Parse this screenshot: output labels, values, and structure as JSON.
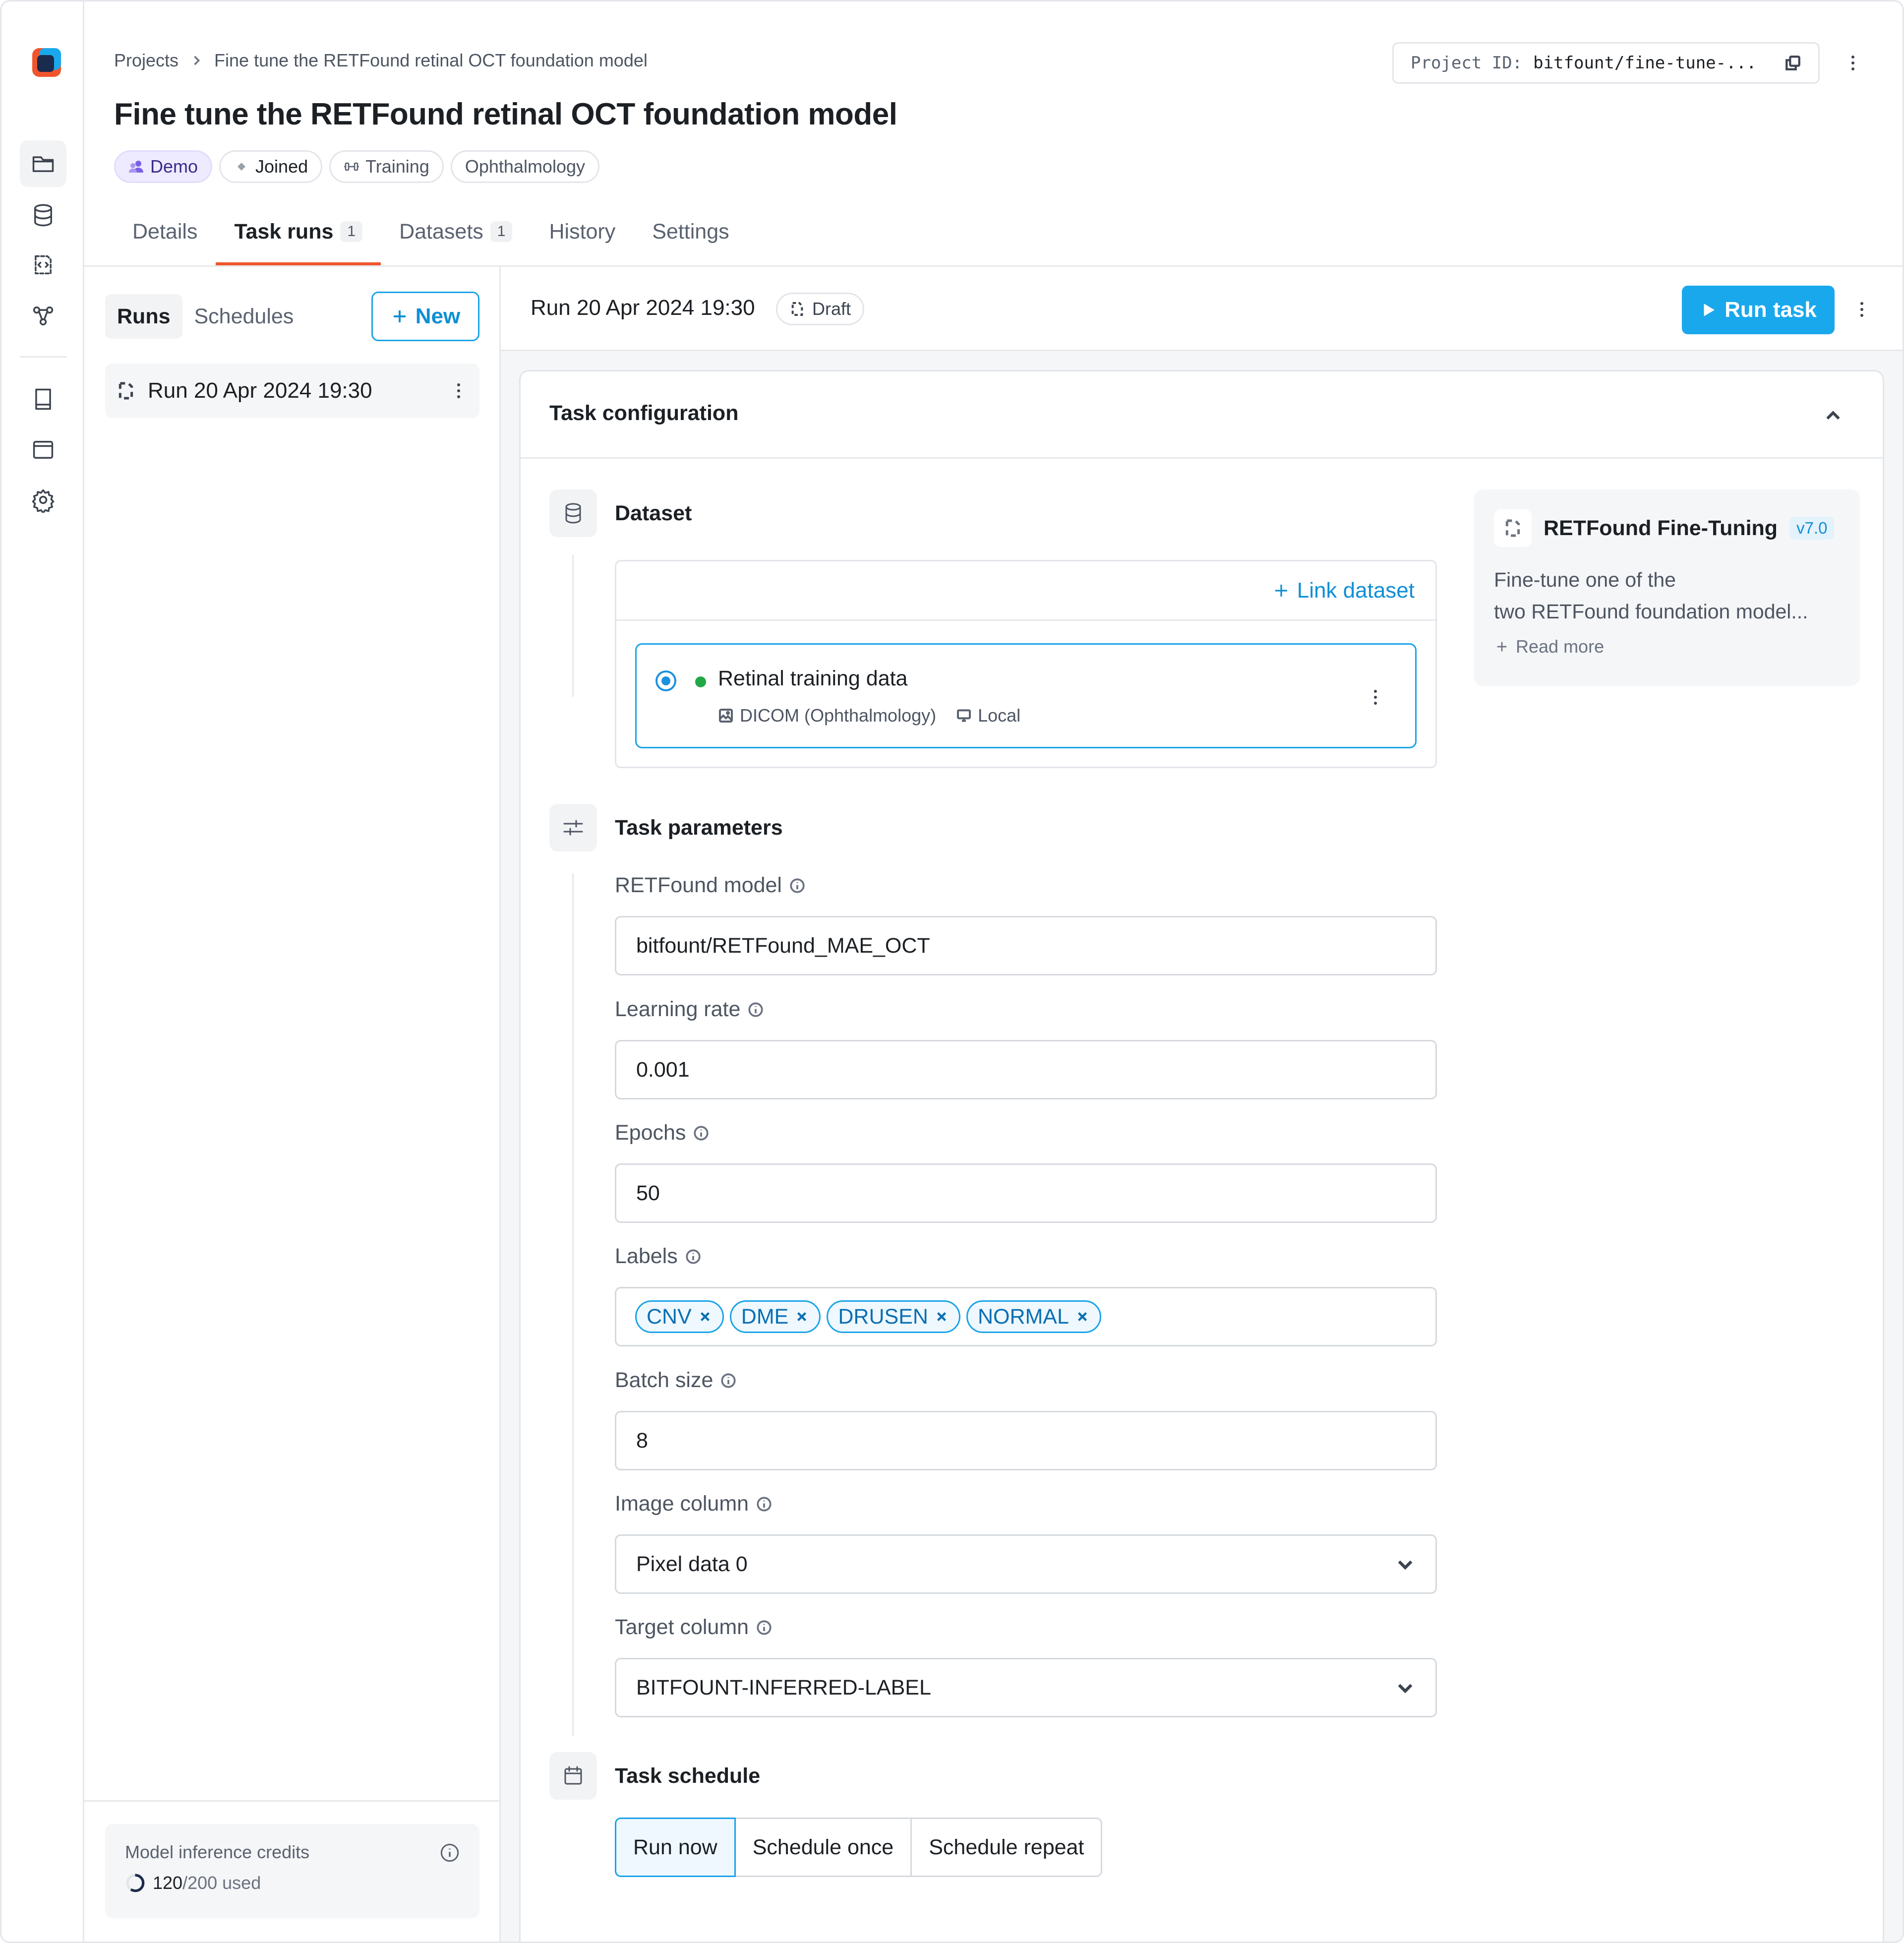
{
  "breadcrumb": {
    "root": "Projects",
    "current": "Fine tune the RETFound retinal OCT foundation model"
  },
  "project": {
    "title": "Fine tune the RETFound retinal OCT foundation model",
    "tags": [
      "Demo",
      "Joined",
      "Training",
      "Ophthalmology"
    ],
    "id_label": "Project ID:",
    "id_value": "bitfount/fine-tune-..."
  },
  "tabs": [
    {
      "label": "Details",
      "count": ""
    },
    {
      "label": "Task runs",
      "count": "1"
    },
    {
      "label": "Datasets",
      "count": "1"
    },
    {
      "label": "History",
      "count": ""
    },
    {
      "label": "Settings",
      "count": ""
    }
  ],
  "runs_panel": {
    "segments": [
      "Runs",
      "Schedules"
    ],
    "new_label": "New",
    "runs": [
      {
        "name": "Run 20 Apr 2024 19:30"
      }
    ],
    "credits": {
      "label": "Model inference credits",
      "used": "120",
      "total": "/200 used",
      "fraction": 0.6
    }
  },
  "run": {
    "title": "Run 20 Apr 2024 19:30",
    "status": "Draft",
    "run_button": "Run task"
  },
  "config": {
    "header": "Task configuration",
    "dataset": {
      "title": "Dataset",
      "link_label": "Link dataset",
      "name": "Retinal training data",
      "type": "DICOM (Ophthalmology)",
      "location": "Local"
    },
    "params_title": "Task parameters",
    "fields": {
      "model": {
        "label": "RETFound model",
        "value": "bitfount/RETFound_MAE_OCT"
      },
      "lr": {
        "label": "Learning rate",
        "value": "0.001"
      },
      "epochs": {
        "label": "Epochs",
        "value": "50"
      },
      "labels": {
        "label": "Labels",
        "values": [
          "CNV",
          "DME",
          "DRUSEN",
          "NORMAL"
        ]
      },
      "batch": {
        "label": "Batch size",
        "value": "8"
      },
      "image_col": {
        "label": "Image column",
        "value": "Pixel data 0"
      },
      "target_col": {
        "label": "Target column",
        "value": "BITFOUNT-INFERRED-LABEL"
      }
    },
    "schedule": {
      "title": "Task schedule",
      "options": [
        "Run now",
        "Schedule once",
        "Schedule repeat"
      ],
      "selected": "Run now"
    }
  },
  "task_card": {
    "name": "RETFound Fine-Tuning",
    "version": "v7.0",
    "desc_line1": "Fine-tune one of the",
    "desc_line2": "two RETFound foundation model...",
    "read_more": "Read more"
  },
  "colors": {
    "accent": "#1aa8ec",
    "tab_underline": "#f0552d",
    "status_ok": "#22a745"
  }
}
